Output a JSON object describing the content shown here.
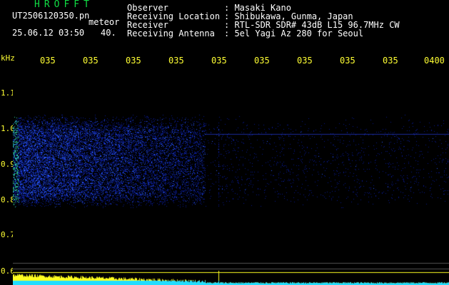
{
  "header": {
    "app_name": "HROFFT",
    "file_name": "UT2506120350.pn",
    "file_type": "meteor",
    "datetime": "25.06.12 03:50",
    "level": "40.",
    "info": [
      {
        "label": "Observer",
        "value": ": Masaki Kano"
      },
      {
        "label": "Receiving Location",
        "value": ": Shibukawa, Gunma, Japan"
      },
      {
        "label": "Receiver",
        "value": ": RTL-SDR SDR# 43dB L15 96.7MHz CW"
      },
      {
        "label": "Receiving Antenna",
        "value": ": 5el Yagi Az 280 for Seoul"
      }
    ]
  },
  "time_axis": {
    "ticks": [
      "035",
      "035",
      "035",
      "035",
      "035",
      "035",
      "035",
      "035",
      "035",
      "0400"
    ]
  },
  "freq_axis": {
    "unit": "kHz",
    "ticks": [
      "1.1",
      "1.0",
      "0.9",
      "0.8",
      "0.7",
      "0.6"
    ]
  },
  "colors": {
    "background": "#000000",
    "axis_text": "#ffff33",
    "app_name": "#11dd44",
    "signal_low": "#0a1a8c",
    "signal_mid": "#2a5cff",
    "signal_high": "#33ddaa",
    "baseline": "#ffff22",
    "baseline_low": "#22ddff"
  }
}
